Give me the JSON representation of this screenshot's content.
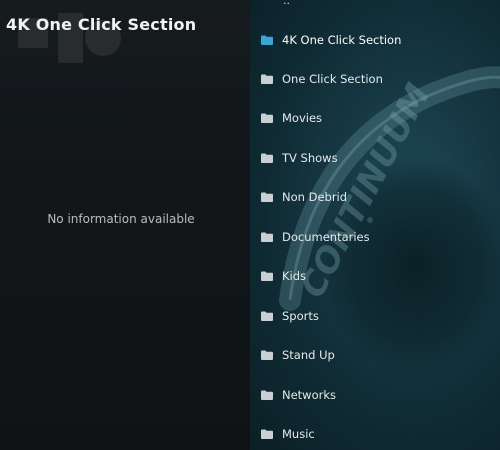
{
  "section": {
    "title": "4K One Click Section",
    "info_text": "No information available"
  },
  "menu": {
    "parent_label": "..",
    "items": [
      {
        "label": "4K One Click Section",
        "selected": true
      },
      {
        "label": "One Click Section",
        "selected": false
      },
      {
        "label": "Movies",
        "selected": false
      },
      {
        "label": "TV Shows",
        "selected": false
      },
      {
        "label": "Non Debrid",
        "selected": false
      },
      {
        "label": "Documentaries",
        "selected": false
      },
      {
        "label": "Kids",
        "selected": false
      },
      {
        "label": "Sports",
        "selected": false
      },
      {
        "label": "Stand Up",
        "selected": false
      },
      {
        "label": "Networks",
        "selected": false
      },
      {
        "label": "Music",
        "selected": false
      }
    ],
    "icon": "folder-icon"
  },
  "colors": {
    "selected_folder": "#3aa6d6",
    "folder": "#c9cfd2",
    "text": "#e6eaec"
  },
  "fanart": {
    "logo_text": "CONTINUUM"
  }
}
